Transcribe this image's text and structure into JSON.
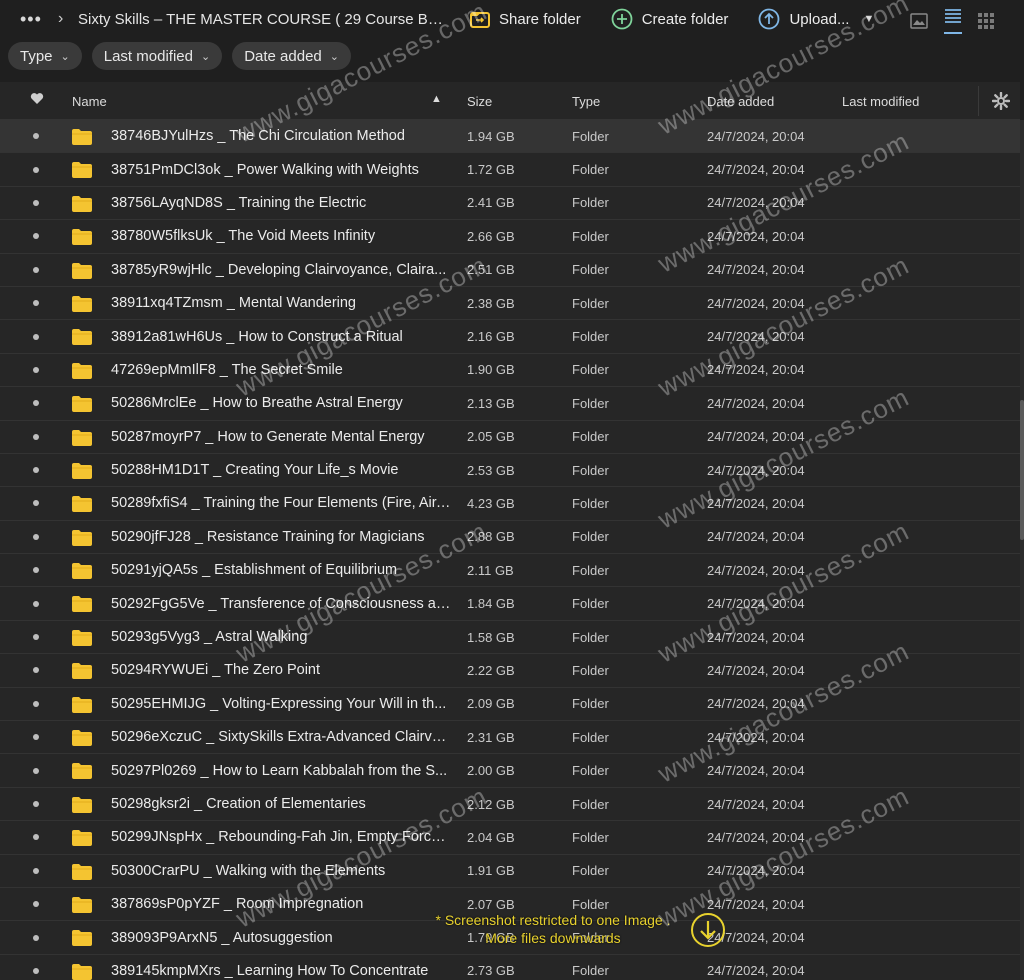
{
  "topbar": {
    "more_label": "•••",
    "breadcrumb": "Sixty Skills – THE MASTER COURSE ( 29 Course Bu...",
    "share_label": "Share folder",
    "create_label": "Create folder",
    "upload_label": "Upload..."
  },
  "filters": [
    {
      "label": "Type"
    },
    {
      "label": "Last modified"
    },
    {
      "label": "Date added"
    }
  ],
  "columns": {
    "name": "Name",
    "size": "Size",
    "type": "Type",
    "date_added": "Date added",
    "last_modified": "Last modified"
  },
  "rows": [
    {
      "name": "38746BJYulHzs _ The Chi Circulation Method",
      "size": "1.94 GB",
      "type": "Folder",
      "date": "24/7/2024, 20:04"
    },
    {
      "name": "38751PmDCl3ok _ Power Walking with Weights",
      "size": "1.72 GB",
      "type": "Folder",
      "date": "24/7/2024, 20:04"
    },
    {
      "name": "38756LAyqND8S _ Training the Electric",
      "size": "2.41 GB",
      "type": "Folder",
      "date": "24/7/2024, 20:04"
    },
    {
      "name": "38780W5flksUk _ The Void Meets Infinity",
      "size": "2.66 GB",
      "type": "Folder",
      "date": "24/7/2024, 20:04"
    },
    {
      "name": "38785yR9wjHlc _ Developing Clairvoyance, Claira...",
      "size": "2.51 GB",
      "type": "Folder",
      "date": "24/7/2024, 20:04"
    },
    {
      "name": "38911xq4TZmsm _ Mental Wandering",
      "size": "2.38 GB",
      "type": "Folder",
      "date": "24/7/2024, 20:04"
    },
    {
      "name": "38912a81wH6Us _ How to Construct a Ritual",
      "size": "2.16 GB",
      "type": "Folder",
      "date": "24/7/2024, 20:04"
    },
    {
      "name": "47269epMmIlF8 _ The Secret Smile",
      "size": "1.90 GB",
      "type": "Folder",
      "date": "24/7/2024, 20:04"
    },
    {
      "name": "50286MrclEe _ How to Breathe Astral Energy",
      "size": "2.13 GB",
      "type": "Folder",
      "date": "24/7/2024, 20:04"
    },
    {
      "name": "50287moyrP7 _ How to Generate Mental Energy",
      "size": "2.05 GB",
      "type": "Folder",
      "date": "24/7/2024, 20:04"
    },
    {
      "name": "50288HM1D1T _ Creating Your Life_s Movie",
      "size": "2.53 GB",
      "type": "Folder",
      "date": "24/7/2024, 20:04"
    },
    {
      "name": "50289fxfiS4 _ Training the Four Elements (Fire, Air,...",
      "size": "4.23 GB",
      "type": "Folder",
      "date": "24/7/2024, 20:04"
    },
    {
      "name": "50290jfFJ28 _ Resistance Training for Magicians",
      "size": "2.88 GB",
      "type": "Folder",
      "date": "24/7/2024, 20:04"
    },
    {
      "name": "50291yjQA5s _ Establishment of Equilibrium",
      "size": "2.11 GB",
      "type": "Folder",
      "date": "24/7/2024, 20:04"
    },
    {
      "name": "50292FgG5Ve _ Transference of Consciousness an...",
      "size": "1.84 GB",
      "type": "Folder",
      "date": "24/7/2024, 20:04"
    },
    {
      "name": "50293g5Vyg3 _ Astral Walking",
      "size": "1.58 GB",
      "type": "Folder",
      "date": "24/7/2024, 20:04"
    },
    {
      "name": "50294RYWUEi _ The Zero Point",
      "size": "2.22 GB",
      "type": "Folder",
      "date": "24/7/2024, 20:04"
    },
    {
      "name": "50295EHMIJG _ Volting-Expressing Your Will in th...",
      "size": "2.09 GB",
      "type": "Folder",
      "date": "24/7/2024, 20:04"
    },
    {
      "name": "50296eXczuC _ SixtySkills Extra-Advanced Clairvo...",
      "size": "2.31 GB",
      "type": "Folder",
      "date": "24/7/2024, 20:04"
    },
    {
      "name": "50297Pl0269 _ How to Learn Kabbalah from the S...",
      "size": "2.00 GB",
      "type": "Folder",
      "date": "24/7/2024, 20:04"
    },
    {
      "name": "50298gksr2i _ Creation of Elementaries",
      "size": "2.12 GB",
      "type": "Folder",
      "date": "24/7/2024, 20:04"
    },
    {
      "name": "50299JNspHx _ Rebounding-Fah Jin, Empty Force ...",
      "size": "2.04 GB",
      "type": "Folder",
      "date": "24/7/2024, 20:04"
    },
    {
      "name": "50300CrarPU _ Walking with the Elements",
      "size": "1.91 GB",
      "type": "Folder",
      "date": "24/7/2024, 20:04"
    },
    {
      "name": "387869sP0pYZF _ Room Impregnation",
      "size": "2.07 GB",
      "type": "Folder",
      "date": "24/7/2024, 20:04"
    },
    {
      "name": "389093P9ArxN5 _ Autosuggestion",
      "size": "1.79 GB",
      "type": "Folder",
      "date": "24/7/2024, 20:04"
    },
    {
      "name": "389145kmpMXrs _ Learning How To Concentrate",
      "size": "2.73 GB",
      "type": "Folder",
      "date": "24/7/2024, 20:04"
    }
  ],
  "notice": {
    "line1": "* Screenshot restricted to one Image .",
    "line2": "More files downwards"
  },
  "watermark": "www.gigacourses.com",
  "colors": {
    "background": "#1f1f1f",
    "list_background": "#262626",
    "folder_yellow": "#f4c431",
    "notice_yellow": "#e8d22e",
    "accent_blue": "#7fb6e6",
    "accent_green": "#7fd39a"
  }
}
